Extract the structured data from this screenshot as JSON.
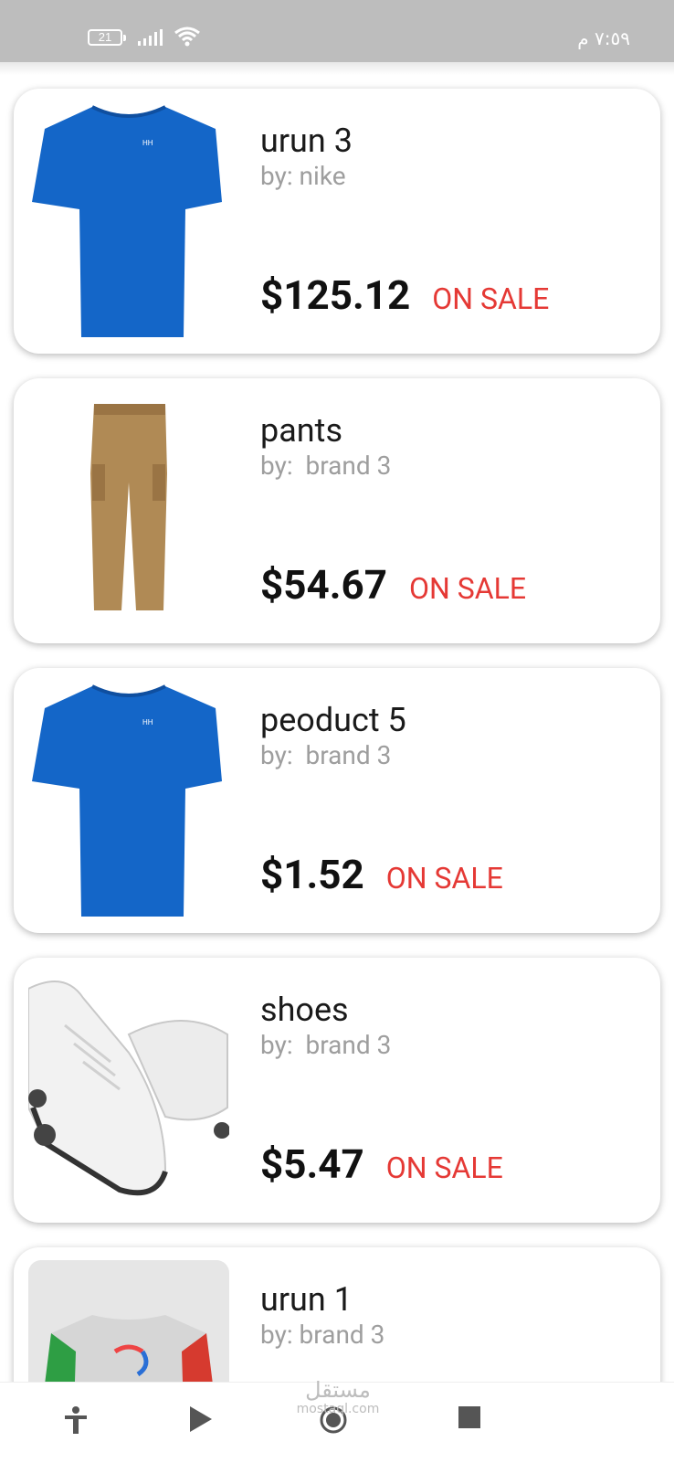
{
  "status_bar": {
    "battery": "21",
    "time": "٧:٥٩ م",
    "icons": [
      "battery-icon",
      "signal-icon",
      "wifi-icon"
    ]
  },
  "products": [
    {
      "title": "urun 3",
      "brand": "by: nike",
      "price": "$125.12",
      "badge": "ON SALE",
      "image": "blue-tshirt"
    },
    {
      "title": "pants",
      "brand": "by:  brand 3",
      "price": "$54.67",
      "badge": "ON SALE",
      "image": "khaki-pants"
    },
    {
      "title": "peoduct 5",
      "brand": "by:  brand 3",
      "price": "$1.52",
      "badge": "ON SALE",
      "image": "blue-tshirt"
    },
    {
      "title": "shoes",
      "brand": "by:  brand 3",
      "price": "$5.47",
      "badge": "ON SALE",
      "image": "white-roller-shoes"
    },
    {
      "title": "urun 1",
      "brand": "by: brand 3",
      "price": "",
      "badge": "",
      "image": "kids-sweater"
    }
  ],
  "nav_bar": {
    "icons": [
      "accessibility-icon",
      "play-icon",
      "record-icon",
      "stop-icon"
    ]
  },
  "watermark": {
    "text": "مستقل",
    "domain": "mostaql.com"
  },
  "colors": {
    "status_bar": "#bdbdbd",
    "sale_red": "#e53935",
    "brand_gray": "#9e9e9e",
    "shirt_blue": "#1466c8",
    "pants_khaki": "#b08a55"
  }
}
